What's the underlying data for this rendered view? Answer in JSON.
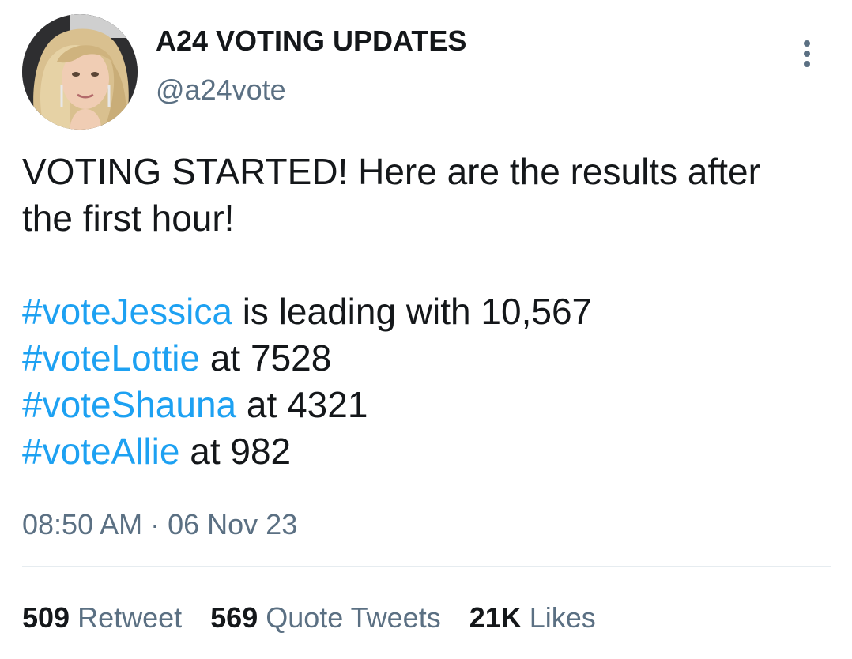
{
  "user": {
    "display_name": "A24 VOTING UPDATES",
    "handle": "@a24vote"
  },
  "more_button": {
    "icon": "more-vertical-icon"
  },
  "tweet": {
    "line1": "VOTING STARTED! Here are the results after",
    "line2": "the first hour!",
    "results": [
      {
        "hashtag": "#voteJessica",
        "text": " is leading with 10,567"
      },
      {
        "hashtag": "#voteLottie",
        "text": " at 7528"
      },
      {
        "hashtag": "#voteShauna",
        "text": " at 4321"
      },
      {
        "hashtag": "#voteAllie",
        "text": " at 982"
      }
    ]
  },
  "meta": {
    "time": "08:50 AM",
    "separator": " · ",
    "date": "06 Nov 23"
  },
  "stats": {
    "retweets": {
      "count": "509",
      "label": " Retweet"
    },
    "quotes": {
      "count": "569",
      "label": " Quote Tweets"
    },
    "likes": {
      "count": "21K",
      "label": " Likes"
    }
  },
  "colors": {
    "link": "#1da1f2",
    "text": "#14171a",
    "secondary": "#5b7083",
    "divider": "#e6ecf0"
  }
}
